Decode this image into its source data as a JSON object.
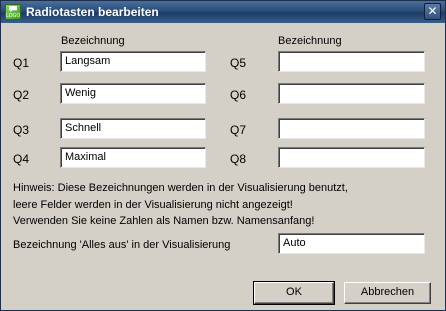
{
  "window": {
    "title": "Radiotasten bearbeiten",
    "app_icon_text": "LOGO",
    "close_glyph": "✕"
  },
  "columns": {
    "left_header": "Bezeichnung",
    "right_header": "Bezeichnung"
  },
  "rows_left": [
    {
      "label": "Q1",
      "value": "Langsam"
    },
    {
      "label": "Q2",
      "value": "Wenig"
    },
    {
      "label": "Q3",
      "value": "Schnell"
    },
    {
      "label": "Q4",
      "value": "Maximal"
    }
  ],
  "rows_right": [
    {
      "label": "Q5",
      "value": ""
    },
    {
      "label": "Q6",
      "value": ""
    },
    {
      "label": "Q7",
      "value": ""
    },
    {
      "label": "Q8",
      "value": ""
    }
  ],
  "hint": {
    "line1": "Hinweis: Diese Bezeichnungen werden in der Visualisierung benutzt,",
    "line2": "leere Felder werden in der Visualisierung nicht angezeigt!",
    "line3": "Verwenden Sie keine Zahlen als Namen bzw. Namensanfang!"
  },
  "all_off": {
    "label": "Bezeichnung 'Alles aus' in der Visualisierung",
    "value": "Auto"
  },
  "buttons": {
    "ok": "OK",
    "cancel": "Abbrechen"
  },
  "colors": {
    "titlebar": "#2a4c79",
    "dialog_background": "#d4d0c8",
    "title_text": "#ffffff",
    "app_icon": "#3a9b25"
  },
  "icons": {
    "app": "app-logo-icon",
    "close": "close-icon"
  }
}
